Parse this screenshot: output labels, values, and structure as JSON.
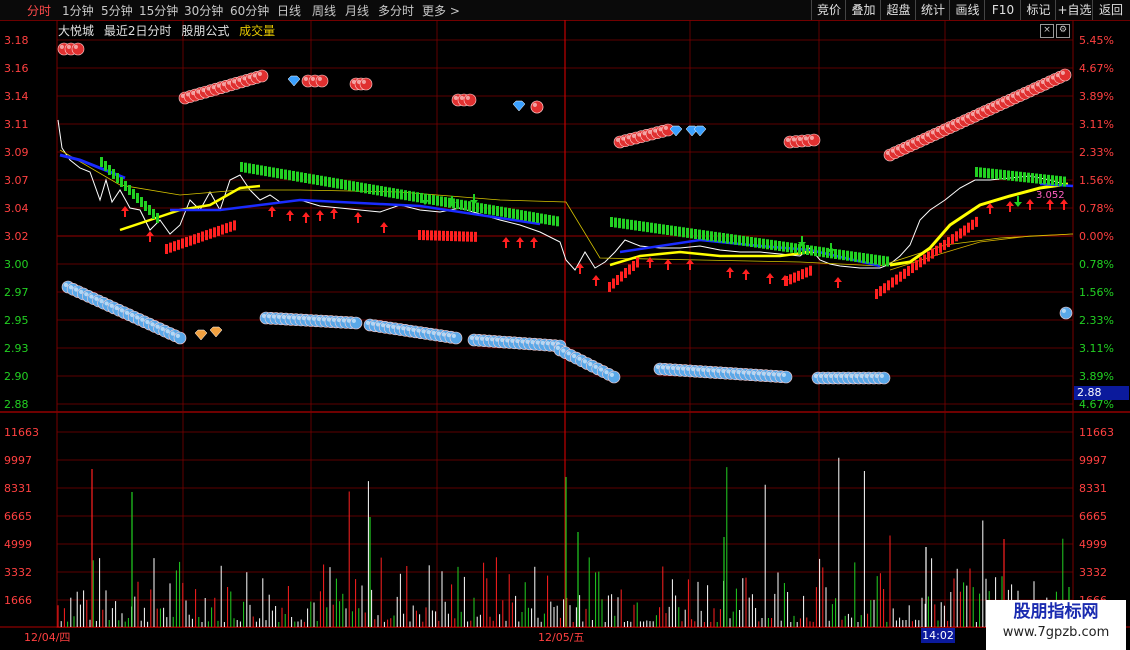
{
  "toolbar": {
    "periods": [
      "分时",
      "1分钟",
      "5分钟",
      "15分钟",
      "30分钟",
      "60分钟",
      "日线",
      "周线",
      "月线",
      "多分时",
      "更多 >"
    ],
    "active_period": "分时",
    "right_buttons": [
      "竞价",
      "叠加",
      "超盘",
      "统计",
      "画线",
      "F10",
      "标记",
      "+自选",
      "返回"
    ]
  },
  "header": {
    "stock_name": "大悦城",
    "subtitle": "最近2日分时",
    "formula": "股朋公式",
    "indicator": "成交量",
    "close_icon": "×",
    "settings_icon": "⚙"
  },
  "colors": {
    "grid": "#7a0000",
    "up": "#ff2020",
    "down": "#22d022",
    "price_line": "#ffffff",
    "avg_line": "#ffff00",
    "ma_blue": "#1a2bff"
  },
  "price_axis": {
    "left": [
      "3.18",
      "3.16",
      "3.14",
      "3.11",
      "3.09",
      "3.07",
      "3.04",
      "3.02",
      "3.00",
      "2.97",
      "2.95",
      "2.93",
      "2.90",
      "2.88"
    ],
    "right": [
      "5.45%",
      "4.67%",
      "3.89%",
      "3.11%",
      "2.33%",
      "1.56%",
      "0.78%",
      "0.00%",
      "0.78%",
      "1.56%",
      "2.33%",
      "3.11%",
      "3.89%",
      "4.67%"
    ]
  },
  "volume_axis": [
    "11663",
    "9997",
    "8331",
    "6665",
    "4999",
    "3332",
    "1666"
  ],
  "dates": [
    "12/04/四",
    "12/05/五"
  ],
  "current_time": "14:02",
  "current_price": "2.88",
  "mini_value": "3.052",
  "watermark": {
    "title": "股朋指标网",
    "url": "www.7gpzb.com"
  }
}
